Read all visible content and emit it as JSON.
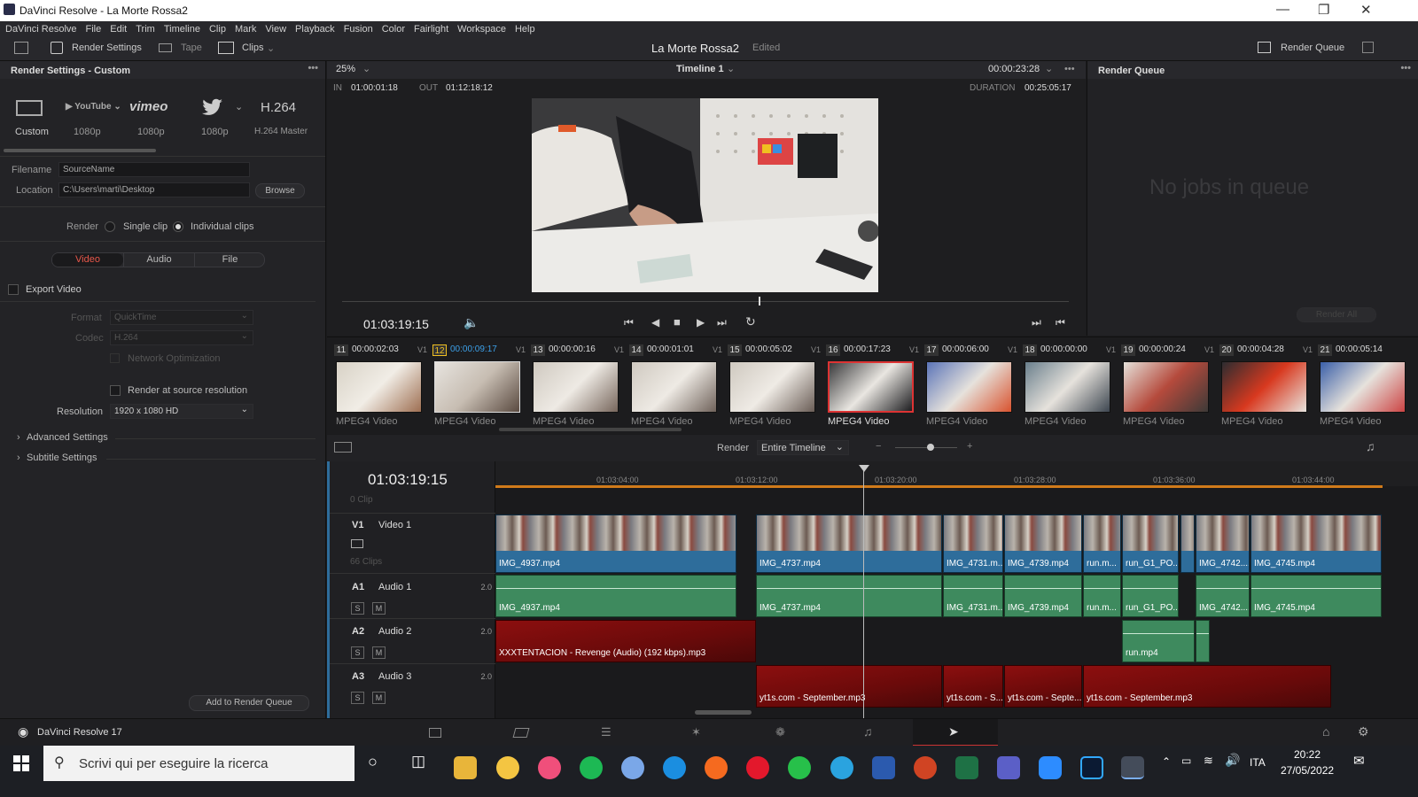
{
  "window": {
    "title": "DaVinci Resolve - La Morte Rossa2"
  },
  "menu": [
    "DaVinci Resolve",
    "File",
    "Edit",
    "Trim",
    "Timeline",
    "Clip",
    "Mark",
    "View",
    "Playback",
    "Fusion",
    "Color",
    "Fairlight",
    "Workspace",
    "Help"
  ],
  "toolbar": {
    "render_settings": "Render Settings",
    "tape": "Tape",
    "clips": "Clips",
    "project": "La Morte Rossa2",
    "status": "Edited",
    "render_queue": "Render Queue"
  },
  "render_settings": {
    "header": "Render Settings - Custom",
    "presets": [
      {
        "name": "Custom",
        "res": ""
      },
      {
        "name": "YouTube",
        "res": "1080p"
      },
      {
        "name": "vimeo",
        "res": "1080p"
      },
      {
        "name": "Twitter",
        "res": "1080p"
      },
      {
        "name": "H.264",
        "res": "H.264 Master"
      }
    ],
    "custom_label": "Custom",
    "filename_label": "Filename",
    "filename": "SourceName",
    "location_label": "Location",
    "location": "C:\\Users\\marti\\Desktop",
    "browse": "Browse",
    "render_label": "Render",
    "single_clip": "Single clip",
    "individual_clips": "Individual clips",
    "tabs": [
      "Video",
      "Audio",
      "File"
    ],
    "export_video": "Export Video",
    "format_label": "Format",
    "format": "QuickTime",
    "codec_label": "Codec",
    "codec": "H.264",
    "network_opt": "Network Optimization",
    "source_res": "Render at source resolution",
    "resolution_label": "Resolution",
    "resolution": "1920 x 1080 HD",
    "advanced": "Advanced Settings",
    "subtitle": "Subtitle Settings",
    "add_queue": "Add to Render Queue"
  },
  "viewer": {
    "zoom": "25%",
    "timeline": "Timeline 1",
    "timecode_top": "00:00:23:28",
    "in_label": "IN",
    "in": "01:00:01:18",
    "out_label": "OUT",
    "out": "01:12:18:12",
    "duration_label": "DURATION",
    "duration": "00:25:05:17",
    "current_tc": "01:03:19:15"
  },
  "render_queue": {
    "header": "Render Queue",
    "empty": "No jobs in queue",
    "render_all": "Render All"
  },
  "clips": [
    {
      "num": "11",
      "tc": "00:00:02:03",
      "v": "V1",
      "cap": "MPEG4 Video"
    },
    {
      "num": "12",
      "tc": "00:00:09:17",
      "v": "V1",
      "cap": "MPEG4 Video"
    },
    {
      "num": "13",
      "tc": "00:00:00:16",
      "v": "V1",
      "cap": "MPEG4 Video"
    },
    {
      "num": "14",
      "tc": "00:00:01:01",
      "v": "V1",
      "cap": "MPEG4 Video"
    },
    {
      "num": "15",
      "tc": "00:00:05:02",
      "v": "V1",
      "cap": "MPEG4 Video"
    },
    {
      "num": "16",
      "tc": "00:00:17:23",
      "v": "V1",
      "cap": "MPEG4 Video"
    },
    {
      "num": "17",
      "tc": "00:00:06:00",
      "v": "V1",
      "cap": "MPEG4 Video"
    },
    {
      "num": "18",
      "tc": "00:00:00:00",
      "v": "V1",
      "cap": "MPEG4 Video"
    },
    {
      "num": "19",
      "tc": "00:00:00:24",
      "v": "V1",
      "cap": "MPEG4 Video"
    },
    {
      "num": "20",
      "tc": "00:00:04:28",
      "v": "V1",
      "cap": "MPEG4 Video"
    },
    {
      "num": "21",
      "tc": "00:00:05:14",
      "v": "",
      "cap": "MPEG4 Video"
    }
  ],
  "timeline": {
    "render_label": "Render",
    "render_range": "Entire Timeline",
    "tc": "01:03:19:15",
    "ruler": [
      "01:03:04:00",
      "01:03:12:00",
      "01:03:20:00",
      "01:03:28:00",
      "01:03:36:00",
      "01:03:44:00"
    ],
    "tracks": {
      "v0": "0 Clip",
      "v1": {
        "id": "V1",
        "name": "Video 1",
        "clips": "66 Clips"
      },
      "a1": {
        "id": "A1",
        "name": "Audio 1",
        "ch": "2.0"
      },
      "a2": {
        "id": "A2",
        "name": "Audio 2",
        "ch": "2.0"
      },
      "a3": {
        "id": "A3",
        "name": "Audio 3",
        "ch": "2.0"
      }
    },
    "video_clips": [
      "IMG_4937.mp4",
      "IMG_4737.mp4",
      "IMG_4731.m...",
      "IMG_4739.mp4",
      "run.m...",
      "run_G1_PO...",
      "IMG_4742....",
      "IMG_4745.mp4"
    ],
    "audio1_clips": [
      "IMG_4937.mp4",
      "IMG_4737.mp4",
      "IMG_4731.m...",
      "IMG_4739.mp4",
      "run.m...",
      "run_G1_PO...",
      "IMG_4742....",
      "IMG_4745.mp4"
    ],
    "audio2_clips": [
      "XXXTENTACION - Revenge (Audio) (192 kbps).mp3",
      "run.mp4"
    ],
    "audio3_clips": [
      "yt1s.com - September.mp3",
      "yt1s.com - S...",
      "yt1s.com - Septe...",
      "yt1s.com - September.mp3"
    ]
  },
  "footer": {
    "app": "DaVinci Resolve 17"
  },
  "taskbar": {
    "search": "Scrivi qui per eseguire la ricerca",
    "lang": "ITA",
    "time": "20:22",
    "date": "27/05/2022"
  }
}
